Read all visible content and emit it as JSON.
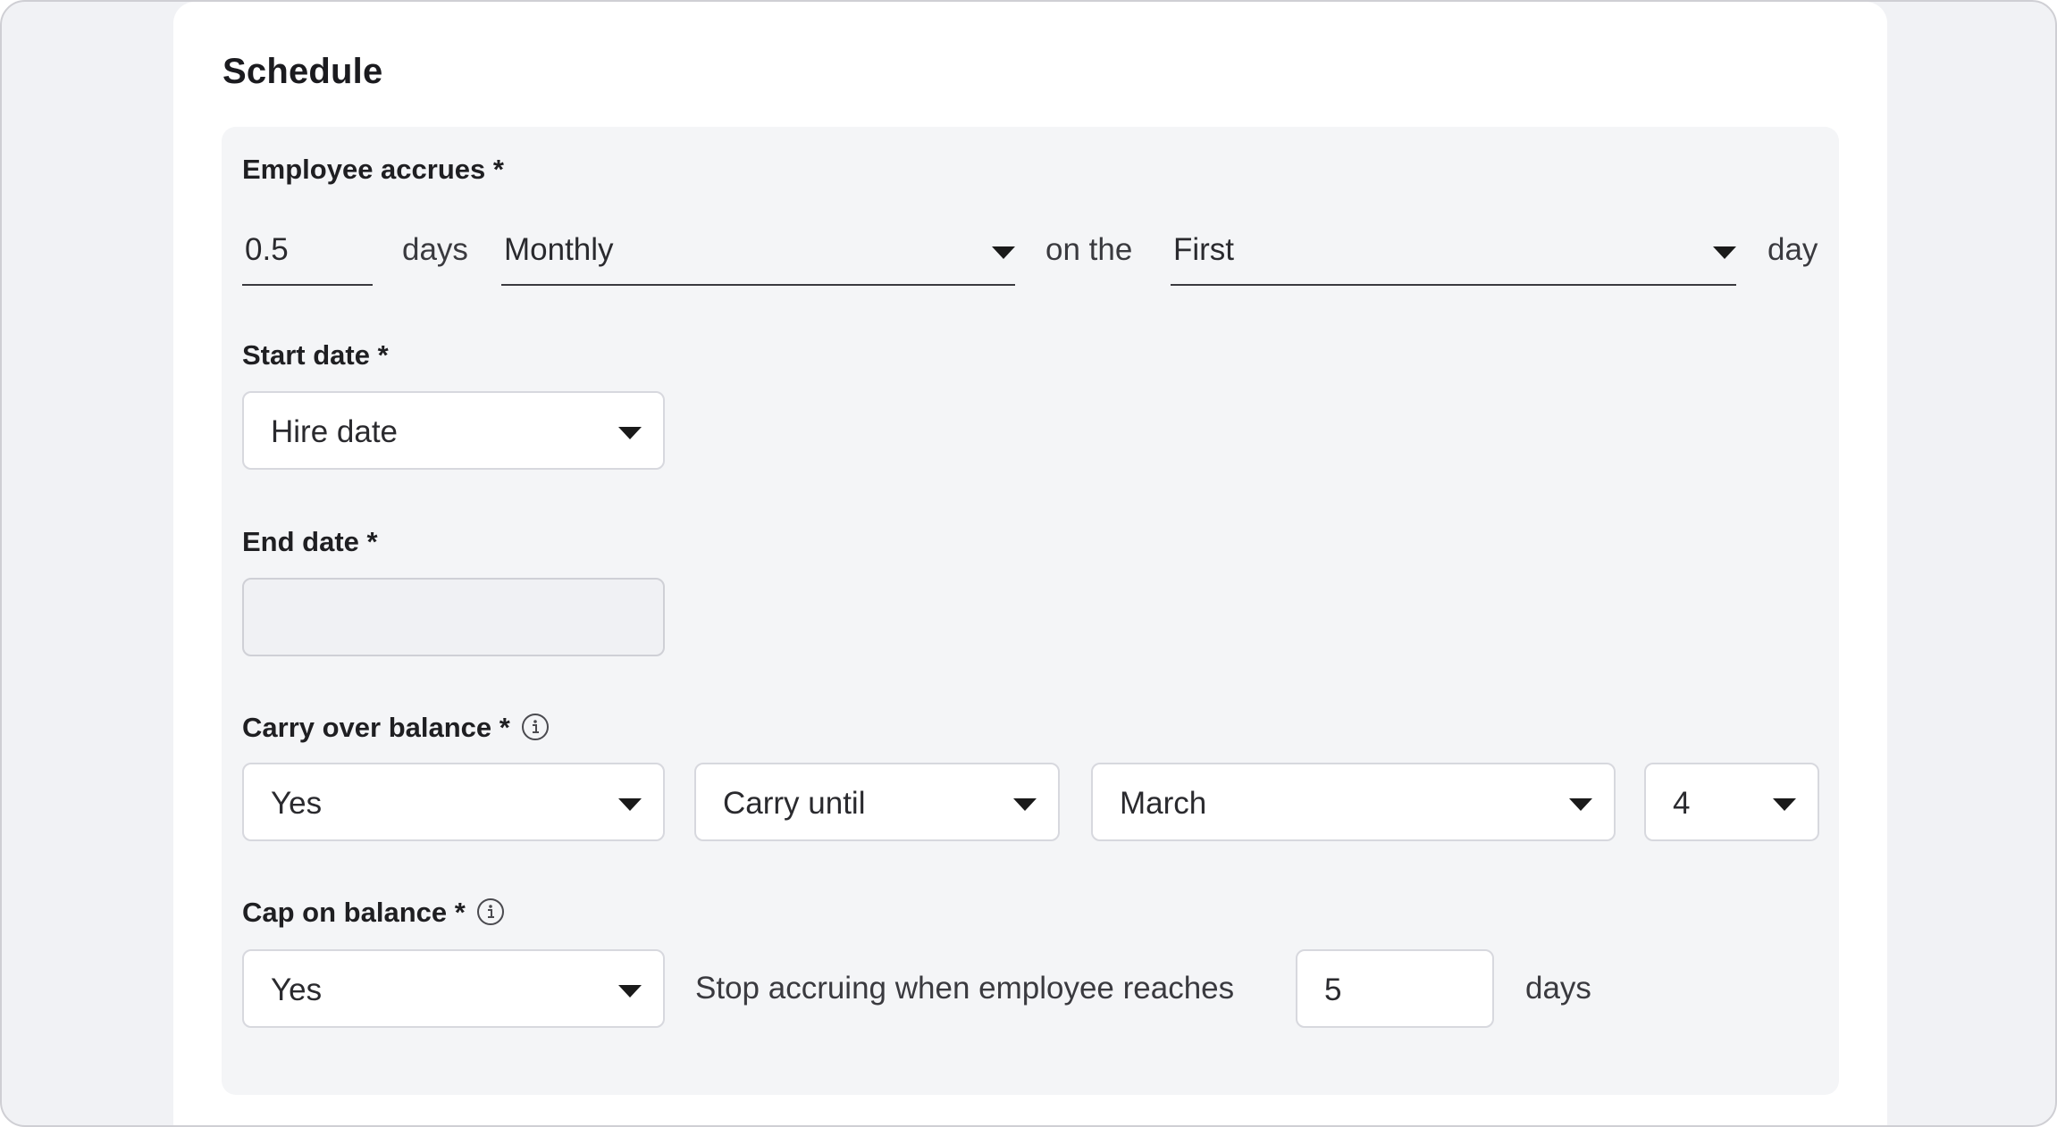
{
  "section": {
    "title": "Schedule"
  },
  "accrual": {
    "label": "Employee accrues *",
    "amount": "0.5",
    "unit": "days",
    "frequency": "Monthly",
    "connector": "on the",
    "day_position": "First",
    "suffix": "day"
  },
  "start_date": {
    "label": "Start date *",
    "value": "Hire date"
  },
  "end_date": {
    "label": "End date *",
    "value": ""
  },
  "carry_over": {
    "label": "Carry over balance *",
    "enabled": "Yes",
    "mode": "Carry until",
    "month": "March",
    "day": "4"
  },
  "cap": {
    "label": "Cap on balance *",
    "enabled": "Yes",
    "description": "Stop accruing when employee reaches",
    "limit": "5",
    "unit": "days"
  },
  "icons": {
    "dropdown": "chevron-down-icon",
    "info": "info-icon"
  },
  "colors": {
    "page_background": "#f1f2f5",
    "card_background": "#ffffff",
    "panel_background": "#f4f5f7",
    "input_border": "#d7d8de",
    "text": "#222222"
  }
}
